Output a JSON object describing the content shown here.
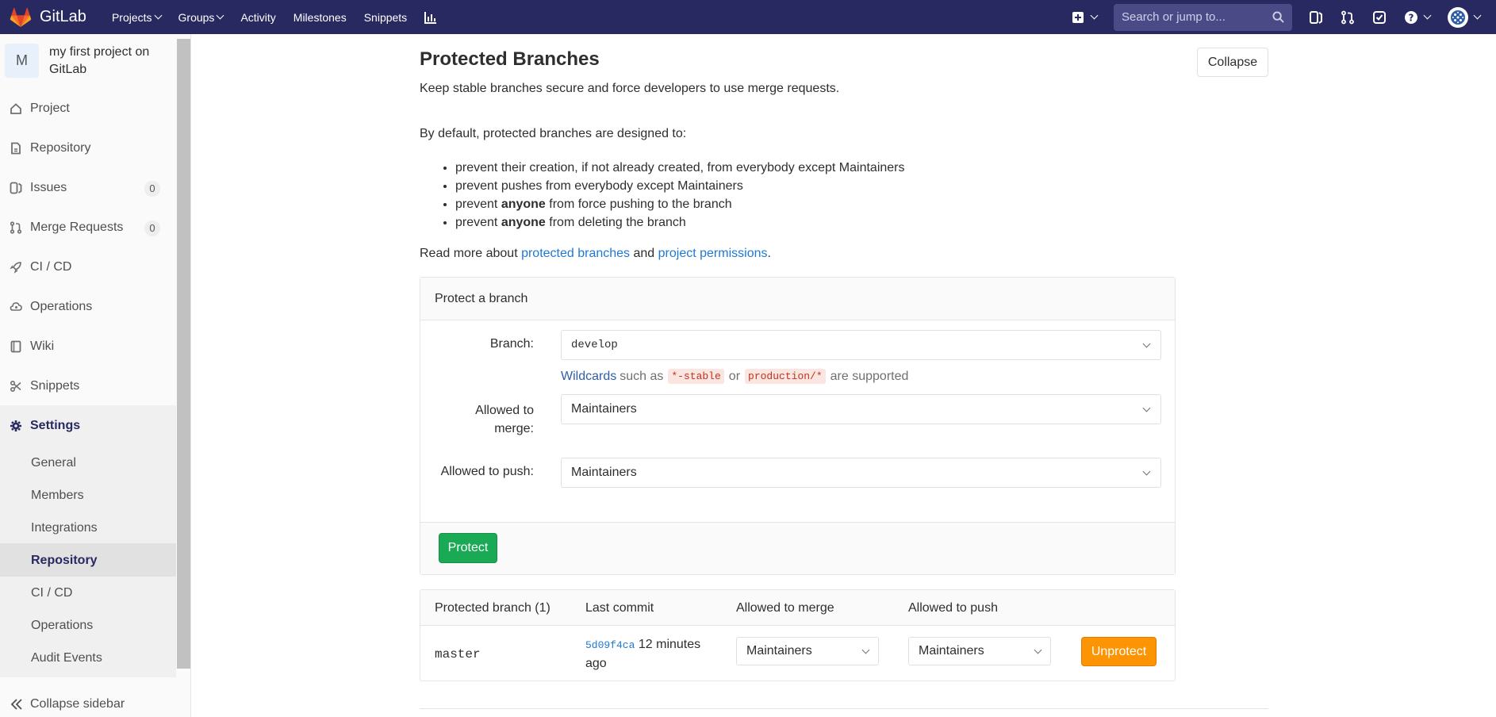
{
  "navbar": {
    "brand": "GitLab",
    "links": [
      {
        "label": "Projects",
        "dropdown": true
      },
      {
        "label": "Groups",
        "dropdown": true
      },
      {
        "label": "Activity",
        "dropdown": false
      },
      {
        "label": "Milestones",
        "dropdown": false
      },
      {
        "label": "Snippets",
        "dropdown": false
      }
    ],
    "search_placeholder": "Search or jump to..."
  },
  "sidebar": {
    "project_initial": "M",
    "project_name": "my first project on GitLab",
    "items": [
      {
        "label": "Project",
        "icon": "home-icon"
      },
      {
        "label": "Repository",
        "icon": "doc-icon"
      },
      {
        "label": "Issues",
        "icon": "issues-icon",
        "count": "0"
      },
      {
        "label": "Merge Requests",
        "icon": "merge-request-icon",
        "count": "0"
      },
      {
        "label": "CI / CD",
        "icon": "rocket-icon"
      },
      {
        "label": "Operations",
        "icon": "cloud-gear-icon"
      },
      {
        "label": "Wiki",
        "icon": "book-icon"
      },
      {
        "label": "Snippets",
        "icon": "scissors-icon"
      },
      {
        "label": "Settings",
        "icon": "gear-icon"
      }
    ],
    "settings_sub": [
      "General",
      "Members",
      "Integrations",
      "Repository",
      "CI / CD",
      "Operations",
      "Audit Events"
    ],
    "active_sub": "Repository",
    "collapse_label": "Collapse sidebar"
  },
  "section": {
    "title": "Protected Branches",
    "description": "Keep stable branches secure and force developers to use merge requests.",
    "collapse_label": "Collapse",
    "intro": "By default, protected branches are designed to:",
    "rules": [
      {
        "pre": "prevent their creation, if not already created, from everybody except Maintainers",
        "bold": "",
        "post": ""
      },
      {
        "pre": "prevent pushes from everybody except Maintainers",
        "bold": "",
        "post": ""
      },
      {
        "pre": "prevent ",
        "bold": "anyone",
        "post": " from force pushing to the branch"
      },
      {
        "pre": "prevent ",
        "bold": "anyone",
        "post": " from deleting the branch"
      }
    ],
    "read_more_pre": "Read more about ",
    "read_more_link1": "protected branches",
    "read_more_mid": " and ",
    "read_more_link2": "project permissions",
    "read_more_post": "."
  },
  "form": {
    "header": "Protect a branch",
    "branch_label": "Branch:",
    "branch_value": "develop",
    "hint_link": "Wildcards",
    "hint_mid1": "such as",
    "hint_code1": "*-stable",
    "hint_mid2": "or",
    "hint_code2": "production/*",
    "hint_post": "are supported",
    "merge_label_line1": "Allowed to",
    "merge_label_line2": "merge:",
    "merge_value": "Maintainers",
    "push_label": "Allowed to push:",
    "push_value": "Maintainers",
    "protect_button": "Protect"
  },
  "table": {
    "headers": [
      "Protected branch (1)",
      "Last commit",
      "Allowed to merge",
      "Allowed to push"
    ],
    "rows": [
      {
        "branch": "master",
        "commit_sha": "5d09f4ca",
        "commit_time_line1": "12 minutes",
        "commit_time_line2": "ago",
        "merge": "Maintainers",
        "push": "Maintainers",
        "action": "Unprotect"
      }
    ]
  },
  "colors": {
    "navbar": "#292961",
    "protect": "#1aaa55",
    "unprotect": "#fc9403",
    "link": "#1f78d1"
  }
}
